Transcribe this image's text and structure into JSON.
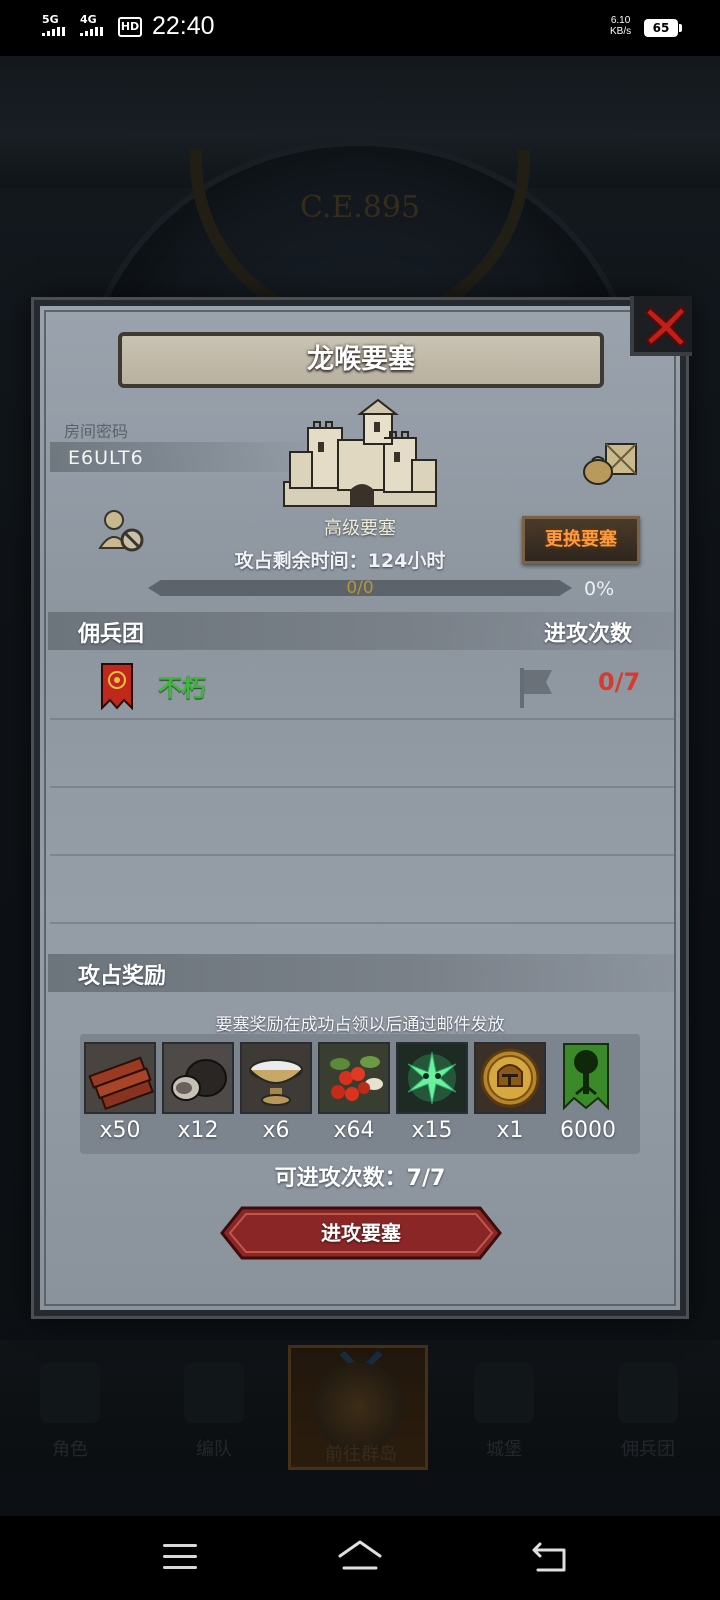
{
  "status_bar": {
    "network_1": "5G",
    "network_2": "4G",
    "hd_badge": "HD",
    "time": "22:40",
    "speed_value": "6.10",
    "speed_unit": "KB/s",
    "battery": "65"
  },
  "background": {
    "year_text": "C.E.895"
  },
  "dialog": {
    "title": "龙喉要塞",
    "room_label": "房间密码",
    "room_code": "E6ULT6",
    "fortress_level": "高级要塞",
    "change_button": "更换要塞",
    "time_left": "攻占剩余时间：124小时",
    "progress_text": "0/0",
    "progress_percent": "0%",
    "progress_fraction": 0,
    "mercenary_header": "佣兵团",
    "attack_times_header": "进攻次数",
    "mercenaries": [
      {
        "name": "不朽",
        "attacks": "0/7"
      }
    ],
    "rewards_header": "攻占奖励",
    "rewards_note": "要塞奖励在成功占领以后通过邮件发放",
    "rewards": [
      {
        "icon": "wood-planks-icon",
        "count": "x50"
      },
      {
        "icon": "truffle-icon",
        "count": "x12"
      },
      {
        "icon": "salt-bowl-icon",
        "count": "x6"
      },
      {
        "icon": "berries-icon",
        "count": "x64"
      },
      {
        "icon": "green-spirit-icon",
        "count": "x15"
      },
      {
        "icon": "golden-helmet-medal-icon",
        "count": "x1"
      },
      {
        "icon": "tree-banner-icon",
        "count": "6000"
      }
    ],
    "available_attacks": "可进攻次数：7/7",
    "attack_button": "进攻要塞"
  },
  "tab_bar": {
    "tabs": [
      {
        "label": "角色",
        "active": false
      },
      {
        "label": "编队",
        "active": false
      },
      {
        "label": "前往群岛",
        "active": true
      },
      {
        "label": "城堡",
        "active": false
      },
      {
        "label": "佣兵团",
        "active": false
      }
    ]
  },
  "colors": {
    "merc_name": "#3cb83a",
    "attack_count": "#d83a2e",
    "change_button_text": "#ff9a3a",
    "attack_button": "#8a2626"
  }
}
